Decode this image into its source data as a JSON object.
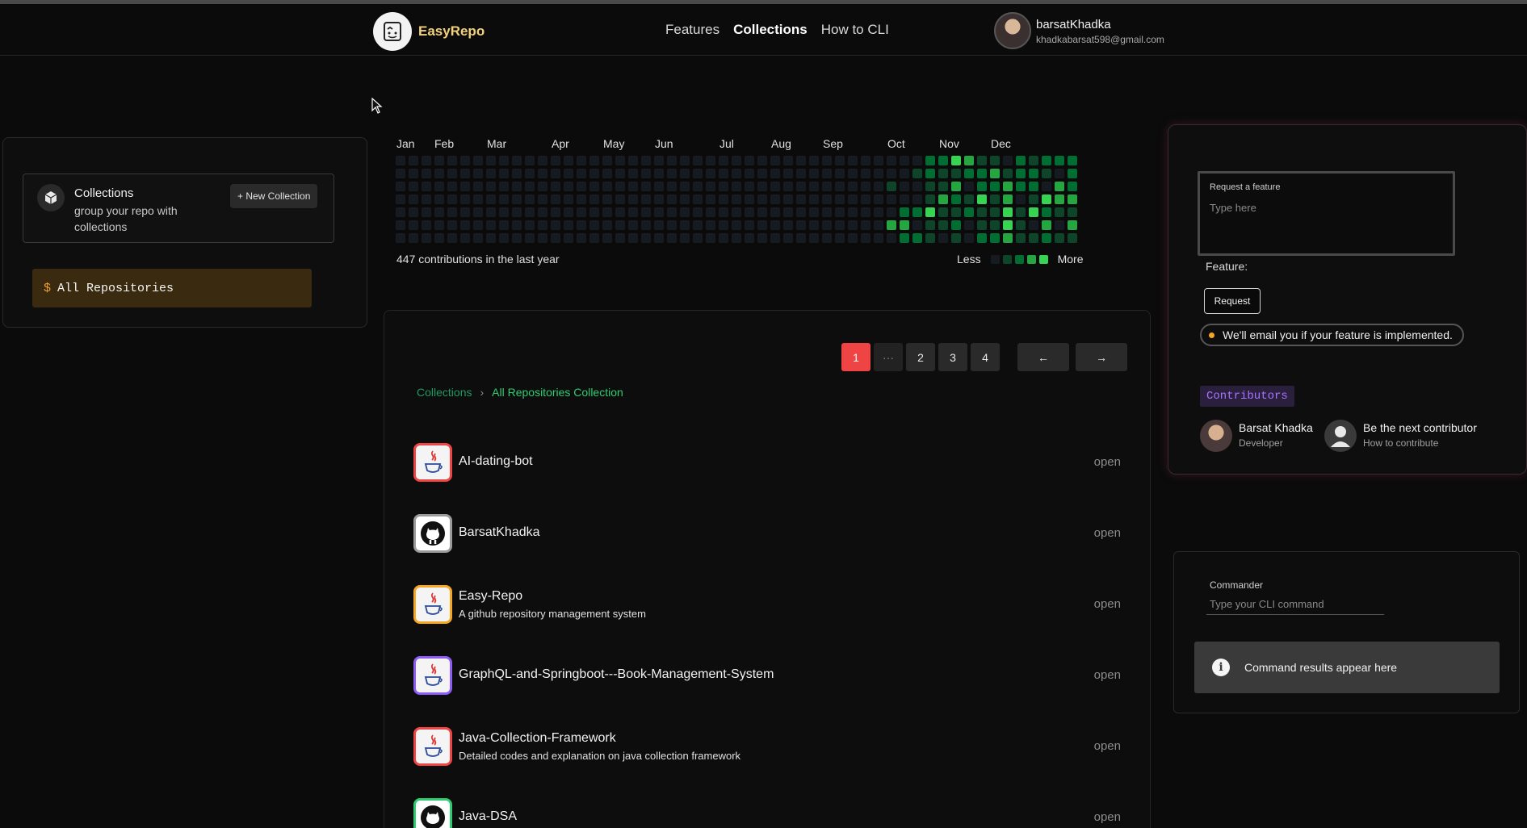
{
  "header": {
    "brand": "EasyRepo",
    "nav": [
      "Features",
      "Collections",
      "How to CLI"
    ],
    "active_nav": "Collections",
    "user_name": "barsatKhadka",
    "user_email": "khadkabarsat598@gmail.com"
  },
  "sidebar": {
    "collections_title": "Collections",
    "collections_desc": "group your repo with collections",
    "new_collection_label": "+ New Collection",
    "all_repos_prompt": "$",
    "all_repos_label": "All Repositories"
  },
  "contributions": {
    "months": [
      "Jan",
      "Feb",
      "Mar",
      "Apr",
      "May",
      "Jun",
      "Jul",
      "Aug",
      "Sep",
      "Oct",
      "Nov",
      "Dec"
    ],
    "summary": "447 contributions in the last year",
    "legend_less": "Less",
    "legend_more": "More",
    "colors": [
      "#161b22",
      "#0e4429",
      "#006d32",
      "#26a641",
      "#39d353"
    ]
  },
  "pagination": {
    "pages": [
      "1",
      "···",
      "2",
      "3",
      "4"
    ],
    "active": "1",
    "prev_label": "←",
    "next_label": "→"
  },
  "breadcrumb": {
    "root": "Collections",
    "separator": "›",
    "current": "All Repositories Collection"
  },
  "repos": [
    {
      "name": "AI-dating-bot",
      "desc": "",
      "icon": "java-icon",
      "border": "#ef4444",
      "action": "open"
    },
    {
      "name": "BarsatKhadka",
      "desc": "",
      "icon": "github-icon",
      "border": "#9a9a9a",
      "action": "open"
    },
    {
      "name": "Easy-Repo",
      "desc": "A github repository management system",
      "icon": "java-icon",
      "border": "#f5a623",
      "action": "open"
    },
    {
      "name": "GraphQL-and-Springboot---Book-Management-System",
      "desc": "",
      "icon": "java-icon",
      "border": "#8b5cf6",
      "action": "open"
    },
    {
      "name": "Java-Collection-Framework",
      "desc": "Detailed codes and explanation on java collection framework",
      "icon": "java-icon",
      "border": "#ef4444",
      "action": "open"
    },
    {
      "name": "Java-DSA",
      "desc": "",
      "icon": "github-icon",
      "border": "#2ecc71",
      "action": "open"
    }
  ],
  "feature_request": {
    "label": "Request a feature",
    "placeholder": "Type here",
    "feature_label": "Feature:",
    "button": "Request",
    "note": "We'll email you if your feature is implemented."
  },
  "contributors": {
    "badge": "Contributors",
    "people": [
      {
        "name": "Barsat Khadka",
        "role": "Developer"
      },
      {
        "name": "Be the next contributor",
        "role": "How to contribute"
      }
    ]
  },
  "commander": {
    "label": "Commander",
    "placeholder": "Type your CLI command",
    "result_text": "Command results appear here"
  }
}
